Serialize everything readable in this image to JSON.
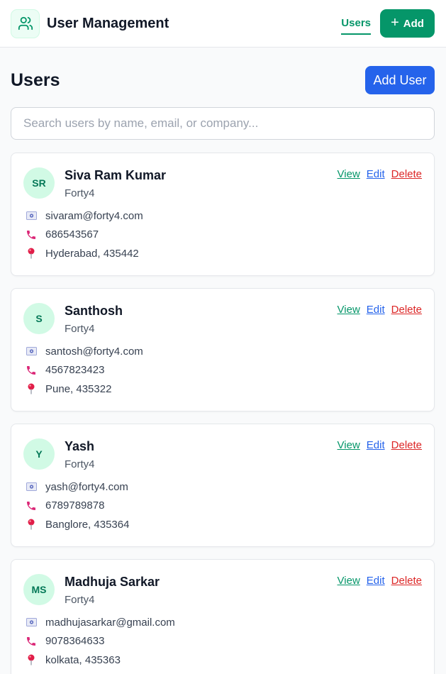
{
  "header": {
    "title": "User Management",
    "nav_users": "Users",
    "add_label": "Add",
    "add_icon": "+",
    "brand_color": "#059669"
  },
  "page": {
    "title": "Users",
    "add_user_label": "Add User",
    "search_placeholder": "Search users by name, email, or company...",
    "search_value": ""
  },
  "actions": {
    "view": "View",
    "edit": "Edit",
    "delete": "Delete"
  },
  "users": [
    {
      "initials": "SR",
      "name": "Siva Ram Kumar",
      "company": "Forty4",
      "email": "sivaram@forty4.com",
      "phone": "686543567",
      "location": "Hyderabad, 435442"
    },
    {
      "initials": "S",
      "name": "Santhosh",
      "company": "Forty4",
      "email": "santosh@forty4.com",
      "phone": "4567823423",
      "location": "Pune, 435322"
    },
    {
      "initials": "Y",
      "name": "Yash",
      "company": "Forty4",
      "email": "yash@forty4.com",
      "phone": "6789789878",
      "location": "Banglore, 435364"
    },
    {
      "initials": "MS",
      "name": "Madhuja Sarkar",
      "company": "Forty4",
      "email": "madhujasarkar@gmail.com",
      "phone": "9078364633",
      "location": "kolkata, 435363"
    }
  ],
  "icons": {
    "logo": "users-icon",
    "email": "email-icon",
    "phone": "phone-icon",
    "location": "location-pin-icon"
  }
}
